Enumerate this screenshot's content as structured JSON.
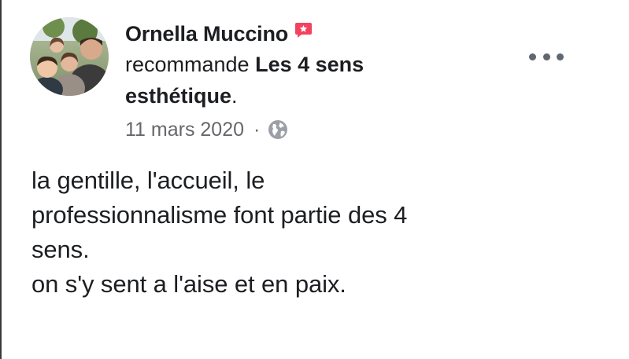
{
  "post": {
    "author": "Ornella Muccino",
    "action": "recommande",
    "page_name_line1": "Les 4 sens",
    "page_name_line2": "esthétique",
    "page_suffix": ".",
    "date": "11 mars 2020",
    "separator": "·",
    "privacy_icon": "globe-icon",
    "recommend_icon": "recommend-badge-icon",
    "more_icon": "more-options-icon",
    "review_text": "la gentille, l'accueil, le\nprofessionnalisme font partie des 4\nsens.\non s'y sent a l'aise et en paix."
  },
  "colors": {
    "text": "#1c1e21",
    "secondary_text": "#65676b",
    "recommend_badge": "#f3425f",
    "dots": "#606770"
  }
}
